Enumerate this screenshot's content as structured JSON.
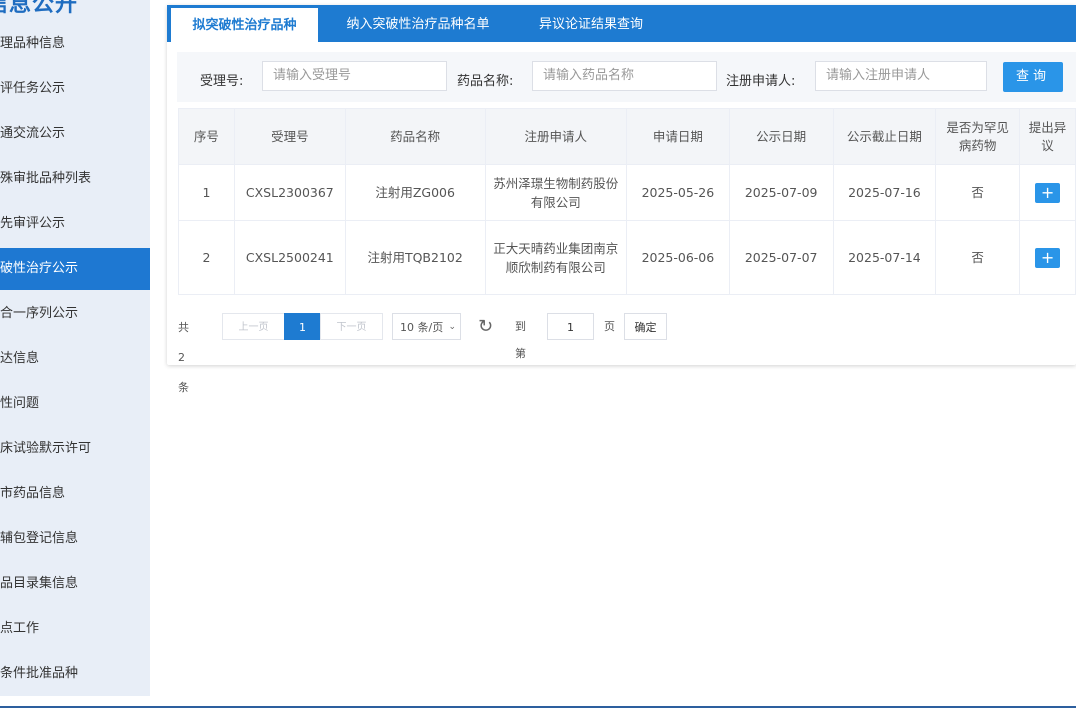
{
  "sidebar": {
    "title": "信息公开",
    "items": [
      {
        "label": "受理品种信息"
      },
      {
        "label": "审评任务公示"
      },
      {
        "label": "沟通交流公示"
      },
      {
        "label": "特殊审批品种列表"
      },
      {
        "label": "优先审评公示"
      },
      {
        "label": "突破性治疗公示"
      },
      {
        "label": "三合一序列公示"
      },
      {
        "label": "送达信息"
      },
      {
        "label": "共性问题"
      },
      {
        "label": "临床试验默示许可"
      },
      {
        "label": "上市药品信息"
      },
      {
        "label": "原辅包登记信息"
      },
      {
        "label": "药品目录集信息"
      },
      {
        "label": "重点工作"
      },
      {
        "label": "附条件批准品种"
      }
    ]
  },
  "tabs": [
    {
      "label": "拟突破性治疗品种"
    },
    {
      "label": "纳入突破性治疗品种名单"
    },
    {
      "label": "异议论证结果查询"
    }
  ],
  "search": {
    "accept_label": "受理号:",
    "accept_placeholder": "请输入受理号",
    "drug_label": "药品名称:",
    "drug_placeholder": "请输入药品名称",
    "applicant_label": "注册申请人:",
    "applicant_placeholder": "请输入注册申请人",
    "query_label": "查询"
  },
  "table": {
    "headers": [
      "序号",
      "受理号",
      "药品名称",
      "注册申请人",
      "申请日期",
      "公示日期",
      "公示截止日期",
      "是否为罕见病药物",
      "提出异议"
    ],
    "rows": [
      {
        "no": "1",
        "accept_no": "CXSL2300367",
        "drug": "注射用ZG006",
        "applicant": "苏州泽璟生物制药股份有限公司",
        "apply_date": "2025-05-26",
        "pub_date": "2025-07-09",
        "deadline": "2025-07-16",
        "rare": "否",
        "action": "+"
      },
      {
        "no": "2",
        "accept_no": "CXSL2500241",
        "drug": "注射用TQB2102",
        "applicant": "正大天晴药业集团南京顺欣制药有限公司",
        "apply_date": "2025-06-06",
        "pub_date": "2025-07-07",
        "deadline": "2025-07-14",
        "rare": "否",
        "action": "+"
      }
    ]
  },
  "pager": {
    "total": "共 2 条",
    "prev": "上一页",
    "current": "1",
    "next": "下一页",
    "page_size": "10 条/页",
    "goto_label": "到第",
    "goto_value": "1",
    "page_unit": "页",
    "confirm": "确定"
  },
  "colors": {
    "accent": "#1e7bd1",
    "sidebar_bg": "#e8eef7",
    "button": "#2a95e8"
  }
}
